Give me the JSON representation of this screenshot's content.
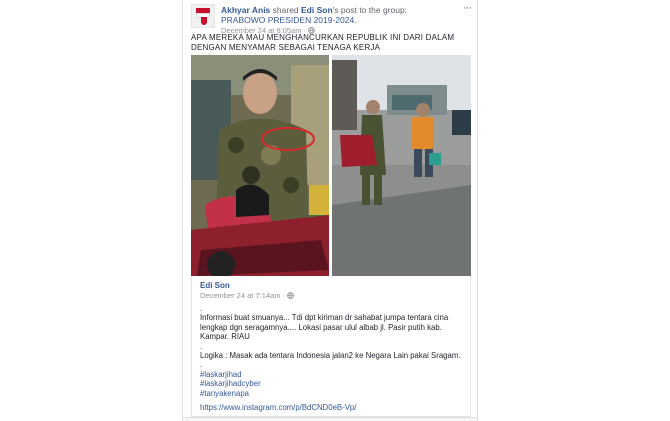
{
  "post": {
    "author": "Akhyar Anis",
    "shared_text": " shared ",
    "shared_author": "Edi Son",
    "post_to_group": "'s post to the group: ",
    "group_name": "PRABOWO PRESIDEN 2019-2024.",
    "time": "December 24 at 8:05am",
    "privacy_dot": " · ",
    "privacy_icon": "globe-icon",
    "more_icon": "···",
    "caption": "APA MEREKA MAU MENGHANCURKAN REPUBLIK INI DARI DALAM DENGAN MENYAMAR SEBAGAI TENAGA KERJA"
  },
  "shared_post": {
    "author": "Edi Son",
    "time": "December 24 at 7:14am",
    "privacy_dot": " · ",
    "dot1": ".",
    "line1": "Informasi buat smuanya... Tdi dpt kiriman dr sahabat jumpa tentara cina lengkap dgn seragamnya.... Lokasi pasar ulul albab jl. Pasir putih kab. Kampar. RIAU",
    "dot2": ".",
    "line2": "Logika : Masak ada tentara Indonesia jalan2 ke Negara Lain pakai Sragam.",
    "dot3": ".",
    "tags": [
      "#laskarjihad",
      "#laskarjihadcyber",
      "#tanyakenapa"
    ],
    "link": "https://www.instagram.com/p/BdCND0eB-Vp/"
  },
  "colors": {
    "link": "#365899",
    "muted": "#90949c",
    "text": "#1d2129",
    "annotation": "#d62b2b"
  }
}
